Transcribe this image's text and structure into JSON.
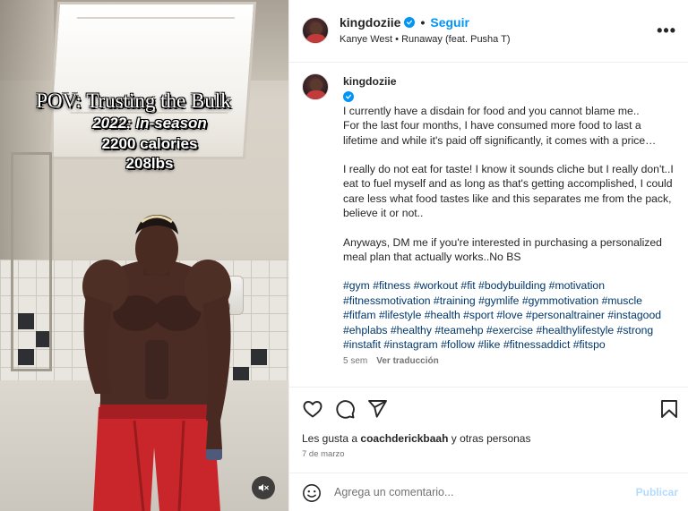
{
  "post": {
    "username": "kingdoziie",
    "follow_label": "Seguir",
    "separator": "•",
    "audio": "Kanye West • Runaway (feat. Pusha T)",
    "more_label": "•••"
  },
  "media": {
    "overlay_title": "POV: Trusting the Bulk",
    "overlay_line1": "2022: In-season",
    "overlay_line2": "2200 calories",
    "overlay_line3": "208lbs",
    "mute_icon": "muted-speaker-icon"
  },
  "caption": {
    "username": "kingdoziie",
    "paragraph1": "I currently have a disdain for food and you cannot blame me..\nFor the last four months, I have consumed more food to last a lifetime and while it's paid off significantly, it comes with a price…",
    "paragraph2": "I really do not eat for taste! I know it sounds cliche but I really don't..I eat to fuel myself and as long as that's getting accomplished, I could care less what food tastes like and this separates me from the pack, believe it or not..",
    "paragraph3": "Anyways, DM me if you're interested in purchasing a personalized meal plan that actually works..No BS",
    "hashtags": "#gym #fitness #workout #fit #bodybuilding #motivation #fitnessmotivation #training #gymlife #gymmotivation #muscle #fitfam #lifestyle #health #sport #love #personaltrainer #instagood #ehplabs #healthy #teamehp #exercise #healthylifestyle #strong #instafit #instagram #follow #like #fitnessaddict #fitspo",
    "age": "5 sem",
    "translate_label": "Ver traducción"
  },
  "actions": {
    "icons": [
      "heart-icon",
      "comment-icon",
      "share-icon",
      "bookmark-icon"
    ]
  },
  "likes": {
    "prefix": "Les gusta a ",
    "user": "coachderickbaah",
    "suffix": " y otras personas"
  },
  "date": "7 de marzo",
  "comment": {
    "placeholder": "Agrega un comentario...",
    "publish_label": "Publicar"
  },
  "colors": {
    "accent": "#0095f6",
    "link": "#00376b",
    "muted": "#737373",
    "publish_disabled": "#b3dbff"
  }
}
